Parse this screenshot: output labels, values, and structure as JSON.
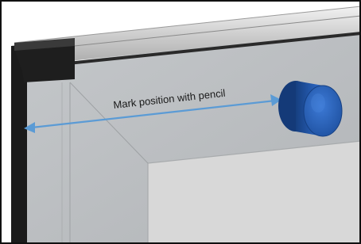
{
  "annotation": {
    "label": "Mark position with pencil"
  },
  "colors": {
    "border": "#111111",
    "frame_dark": "#1c1c1c",
    "rail_light": "#d9d9d9",
    "panel_gray": "#b9bcbf",
    "inner_gray": "#d7d7d7",
    "arrow_blue": "#5b9bd5",
    "knob_blue": "#1f55a8"
  },
  "icons": {
    "knob": "cylinder-knob-icon",
    "arrow": "double-headed-arrow-icon"
  }
}
